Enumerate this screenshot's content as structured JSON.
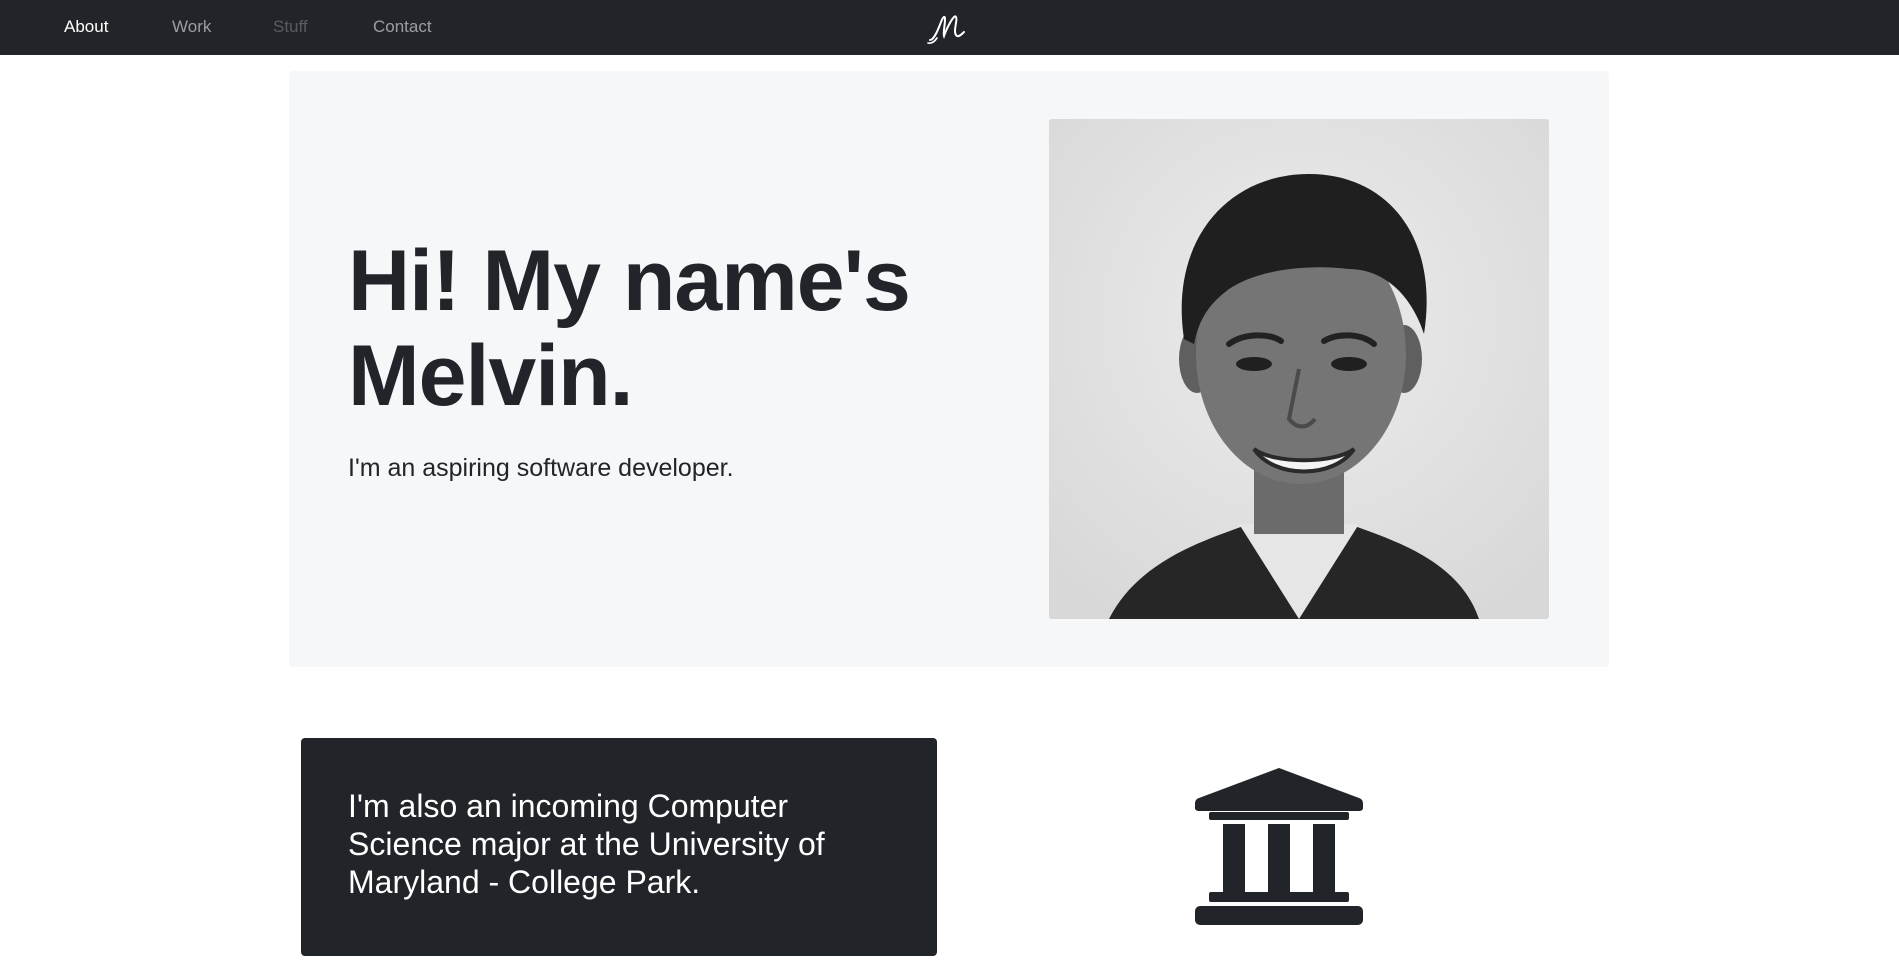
{
  "nav": {
    "items": [
      {
        "label": "About",
        "state": "active"
      },
      {
        "label": "Work",
        "state": "normal"
      },
      {
        "label": "Stuff",
        "state": "disabled"
      },
      {
        "label": "Contact",
        "state": "normal"
      }
    ],
    "brand": {
      "text": "M",
      "icon": "signature-monogram"
    }
  },
  "hero": {
    "title": "Hi! My name's Melvin.",
    "subtitle": "I'm an aspiring software developer.",
    "photo": {
      "icon": "portrait-photo"
    }
  },
  "info": {
    "text": "I'm also an incoming Computer Science major at the University of Maryland - College Park.",
    "icon": "university-icon"
  },
  "colors": {
    "navbar_bg": "#212529",
    "hero_bg": "#f6f7f9",
    "card_bg": "#212529",
    "text": "#212529"
  }
}
